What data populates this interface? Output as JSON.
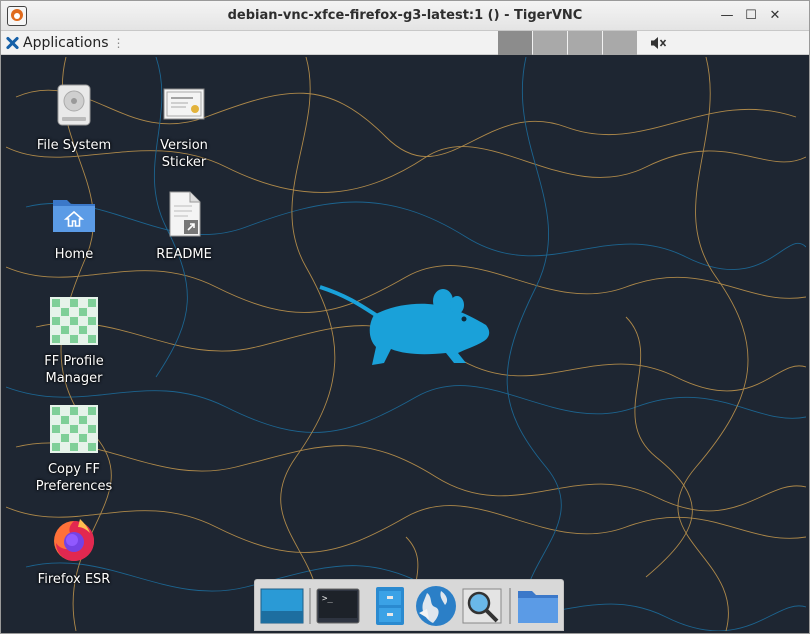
{
  "window": {
    "title": "debian-vnc-xfce-firefox-g3-latest:1 () - TigerVNC"
  },
  "titlebar_controls": {
    "minimize": "—",
    "maximize": "☐",
    "close": "✕"
  },
  "panel": {
    "applications_label": "Applications",
    "menu_separator": "⋮",
    "workspaces": 4,
    "volume_state": "muted"
  },
  "desktop_icons": [
    {
      "label": "File System",
      "icon": "hard-drive-icon"
    },
    {
      "label": "Version\nSticker",
      "icon": "certificate-icon"
    },
    {
      "label": "Home",
      "icon": "home-folder-icon"
    },
    {
      "label": "README",
      "icon": "document-link-icon"
    },
    {
      "label": "FF Profile\nManager",
      "icon": "script-icon"
    },
    {
      "label": "Copy FF\nPreferences",
      "icon": "script-icon"
    },
    {
      "label": "Firefox ESR",
      "icon": "firefox-icon"
    }
  ],
  "dock_items": [
    "show-desktop-icon",
    "terminal-icon",
    "file-manager-icon",
    "web-browser-icon",
    "app-finder-icon",
    "folder-icon"
  ],
  "colors": {
    "desktop_bg": "#1e2632",
    "mouse_logo": "#1aa1d9",
    "contour_orange": "#c79a4e",
    "contour_blue": "#1c6fa0"
  }
}
